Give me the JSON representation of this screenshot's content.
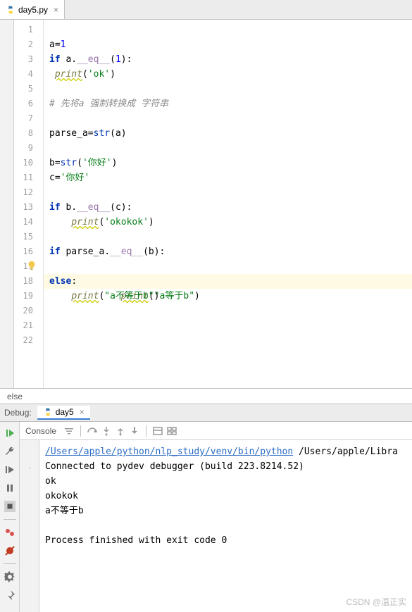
{
  "tab": {
    "filename": "day5.py",
    "close": "×"
  },
  "gutter": {
    "lines": [
      "1",
      "2",
      "3",
      "4",
      "5",
      "6",
      "7",
      "8",
      "9",
      "10",
      "11",
      "12",
      "13",
      "14",
      "15",
      "16",
      "17",
      "18",
      "19",
      "20",
      "21",
      "22"
    ]
  },
  "code": {
    "l2": {
      "a": "a",
      "eq": "=",
      "one": "1"
    },
    "l3": {
      "if": "if",
      "a": " a.",
      "eq": "__eq__",
      "open": "(",
      "one": "1",
      "close": "):"
    },
    "l4": {
      "sp": " ",
      "print": "print",
      "open": "(",
      "s": "'ok'",
      "close": ")"
    },
    "l6": {
      "c": "# 先将a 强制转换成 字符串"
    },
    "l8": {
      "lhs": "parse_a",
      "eq": "=",
      "str": "str",
      "open": "(",
      "arg": "a",
      "close": ")"
    },
    "l10": {
      "lhs": "b",
      "eq": "=",
      "str": "str",
      "open": "(",
      "s": "'你好'",
      "close": ")"
    },
    "l11": {
      "lhs": "c",
      "eq": "=",
      "s": "'你好'"
    },
    "l13": {
      "if": "if",
      "b": " b.",
      "eq": "__eq__",
      "open": "(",
      "arg": "c",
      "close": "):"
    },
    "l14": {
      "sp": "    ",
      "print": "print",
      "open": "(",
      "s": "'okokok'",
      "close": ")"
    },
    "l16": {
      "if": "if",
      "p": " parse_a.",
      "eq": "__eq__",
      "open": "(",
      "arg": "b",
      "close": "):"
    },
    "l17": {
      "sp": "     ",
      "print": "print",
      "open": "(",
      "s": "\"a等于b\"",
      "close": ")"
    },
    "l18": {
      "else": "else",
      "colon": ":"
    },
    "l19": {
      "sp": "    ",
      "print": "print",
      "open": "(",
      "s": "\"a不等于b\"",
      "close": ")"
    }
  },
  "breadcrumb": {
    "text": "else"
  },
  "debug": {
    "label": "Debug:",
    "config": "day5",
    "close": "×"
  },
  "console": {
    "tab": "Console",
    "link": "/Users/apple/python/nlp_study/venv/bin/python",
    "rest": " /Users/apple/Libra",
    "line2": "Connected to pydev debugger (build 223.8214.52)",
    "line3": "ok",
    "line4": "okokok",
    "line5": "a不等于b",
    "line6": "",
    "line7": "Process finished with exit code 0"
  },
  "watermark": "CSDN @温正实"
}
